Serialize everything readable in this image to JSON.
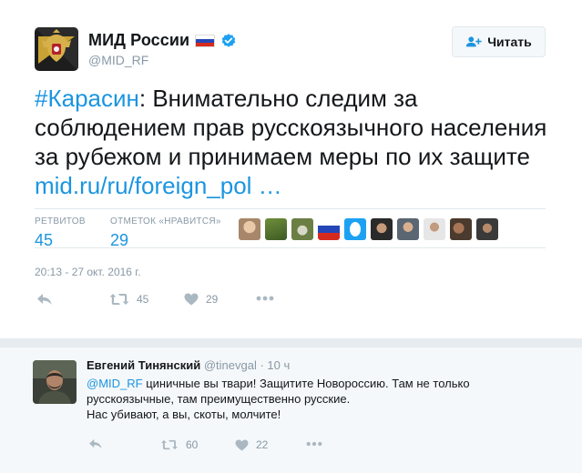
{
  "tweet": {
    "display_name": "МИД России",
    "handle": "@MID_RF",
    "follow_label": "Читать",
    "text_hashtag": "#Карасин",
    "text_body": ": Внимательно следим за соблюдением прав русскоязычного населения за рубежом и принимаем меры по их защите ",
    "text_link": "mid.ru/ru/foreign_pol  …",
    "retweets_label": "РЕТВИТОВ",
    "retweets_count": "45",
    "likes_label": "ОТМЕТОК «НРАВИТСЯ»",
    "likes_count": "29",
    "timestamp": "20:13 - 27 окт. 2016 г.",
    "action_retweet_count": "45",
    "action_like_count": "29",
    "liker_avatars": [
      "avatar",
      "avatar",
      "avatar",
      "avatar",
      "avatar",
      "avatar",
      "avatar",
      "avatar",
      "avatar",
      "avatar"
    ]
  },
  "reply": {
    "name": "Евгений Тинянский",
    "handle": "@tinevgal",
    "time": "· 10 ч",
    "mention": "@MID_RF",
    "line1_rest": " циничные вы твари! Защитите Новороссию. Там не только",
    "line2": "русскоязычные, там преимущественно русские.",
    "line3": "Нас убивают, а вы, скоты, молчите!",
    "action_retweet_count": "60",
    "action_like_count": "22"
  },
  "colors": {
    "link": "#1b95e0",
    "muted": "#8899a6",
    "icon": "#aab8c2",
    "reply_bg": "#f5f8fa"
  }
}
